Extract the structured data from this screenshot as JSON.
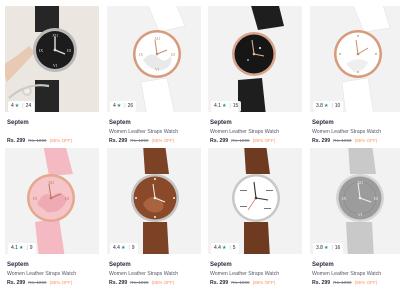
{
  "products": [
    {
      "rating": "4",
      "count": "24",
      "brand": "Septem",
      "name": "",
      "price": "Rs. 299",
      "mrp": "Rs. 1999",
      "off": "(85% OFF)",
      "bg": "#ede9e4"
    },
    {
      "rating": "4",
      "count": "26",
      "brand": "Septem",
      "name": "Women Leather Straps Watch",
      "price": "Rs. 299",
      "mrp": "Rs. 1999",
      "off": "(85% OFF)",
      "bg": "#f3f3f3"
    },
    {
      "rating": "4.1",
      "count": "15",
      "brand": "Septem",
      "name": "Women Leather Straps Watch",
      "price": "Rs. 299",
      "mrp": "Rs. 1999",
      "off": "(85% OFF)",
      "bg": "#f3f3f3"
    },
    {
      "rating": "3.8",
      "count": "10",
      "brand": "Septem",
      "name": "Women Leather Straps Watch",
      "price": "Rs. 299",
      "mrp": "Rs. 1999",
      "off": "(85% OFF)",
      "bg": "#f3f3f3"
    },
    {
      "rating": "4.1",
      "count": "9",
      "brand": "Septem",
      "name": "Women Leather Straps Watch",
      "price": "Rs. 299",
      "mrp": "Rs. 1999",
      "off": "(85% OFF)",
      "bg": "#f3f3f3"
    },
    {
      "rating": "4.4",
      "count": "9",
      "brand": "Septem",
      "name": "Women Leather Straps Watch",
      "price": "Rs. 299",
      "mrp": "Rs. 1999",
      "off": "(85% OFF)",
      "bg": "#f3f3f3"
    },
    {
      "rating": "4.4",
      "count": "5",
      "brand": "Septem",
      "name": "Women Leather Straps Watch",
      "price": "Rs. 299",
      "mrp": "Rs. 1999",
      "off": "(85% OFF)",
      "bg": "#f3f3f3"
    },
    {
      "rating": "3.8",
      "count": "16",
      "brand": "Septem",
      "name": "Women Leather Straps Watch",
      "price": "Rs. 299",
      "mrp": "Rs. 1999",
      "off": "(85% OFF)",
      "bg": "#f3f3f3"
    }
  ],
  "colors": {
    "star": "#14958f",
    "discount": "#ff905a",
    "text": "#282c3f",
    "muted": "#7e818c"
  }
}
